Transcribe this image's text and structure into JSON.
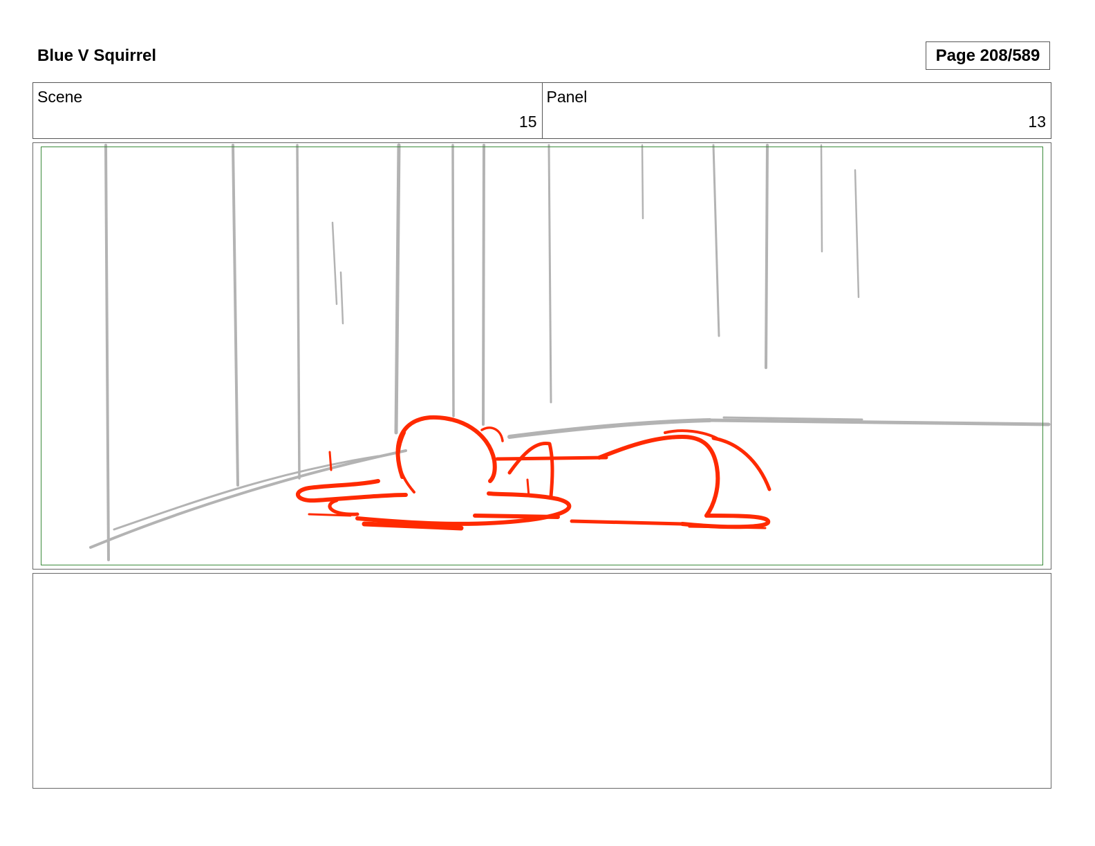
{
  "header": {
    "project_title": "Blue V Squirrel",
    "page_label": "Page 208/589"
  },
  "info": {
    "scene_label": "Scene",
    "scene_value": "15",
    "panel_label": "Panel",
    "panel_value": "13"
  },
  "panel": {
    "sketch_colors": {
      "background_lines": "#b3b3b3",
      "character_lines": "#ff2a00",
      "safe_area": "#3a8a3a"
    }
  },
  "notes": {
    "text": ""
  }
}
